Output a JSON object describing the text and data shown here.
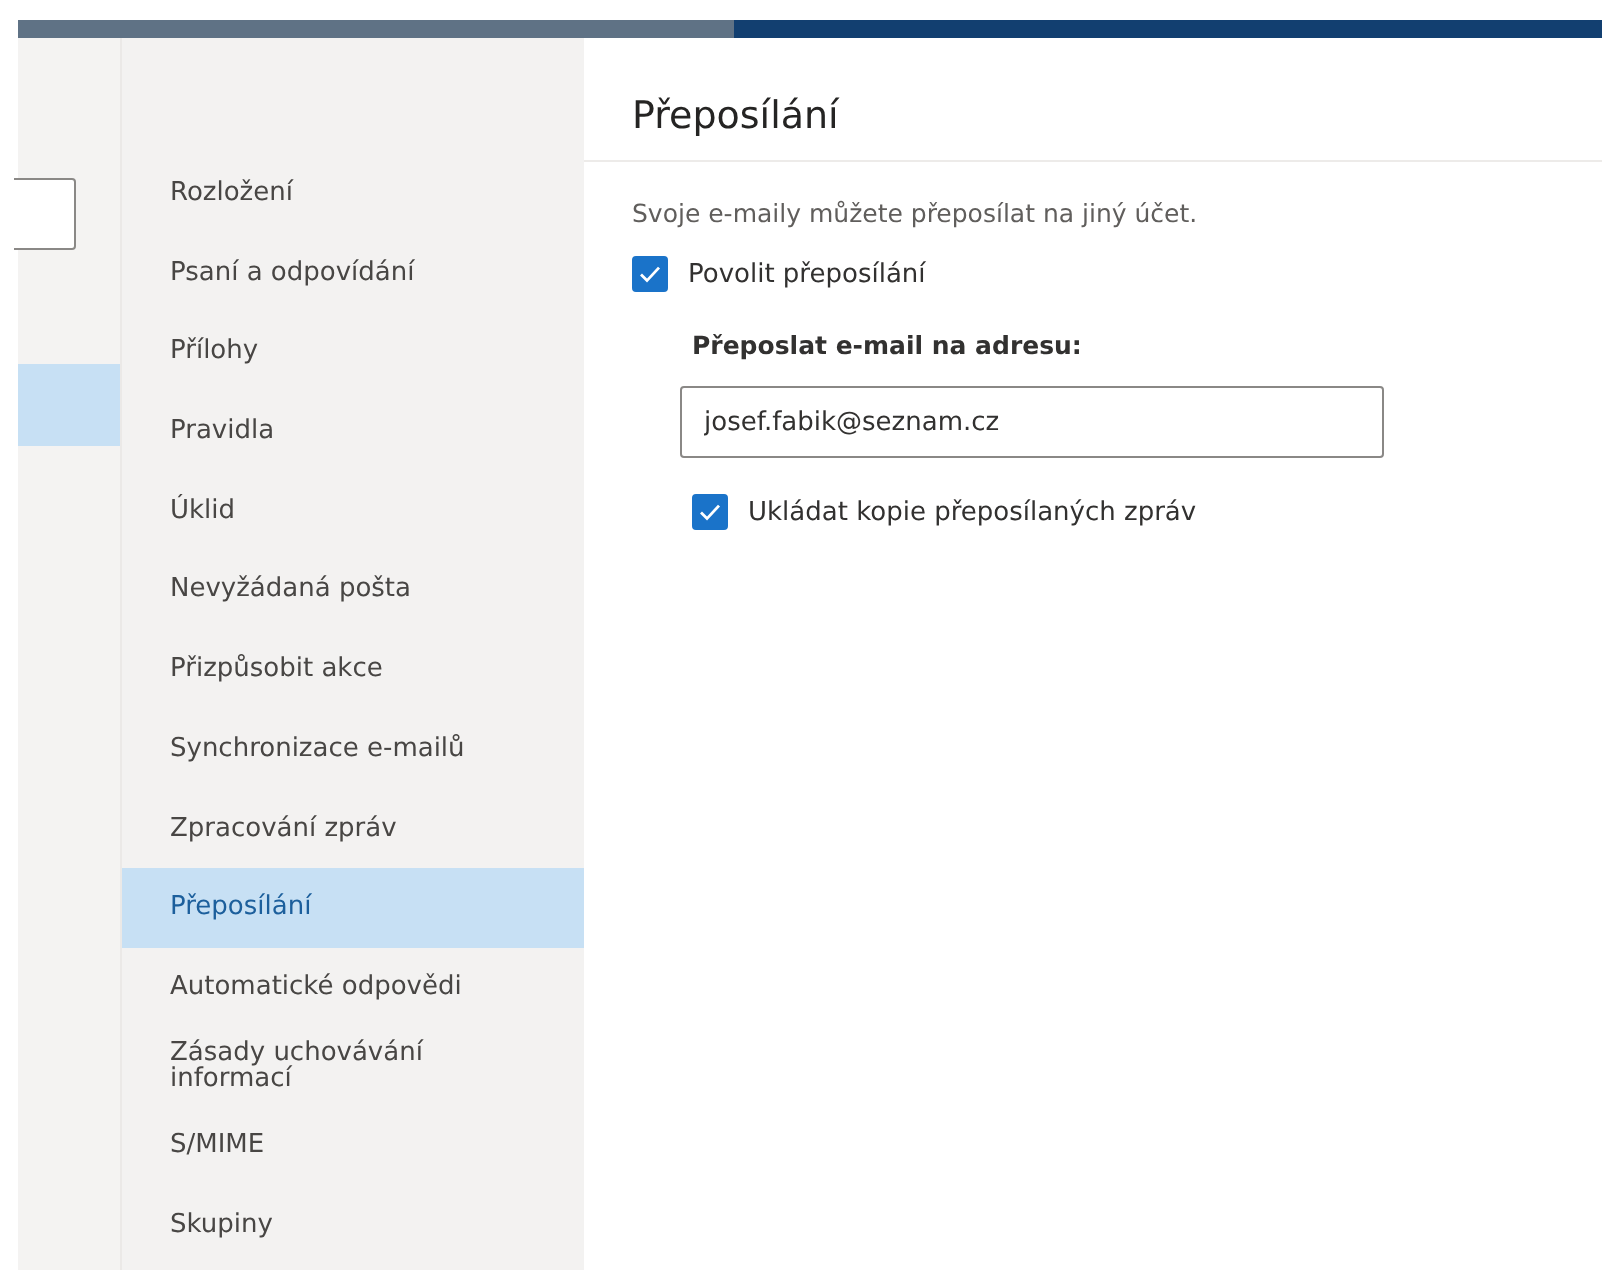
{
  "settings_menu": [
    {
      "label": "Rozložení",
      "selected": false
    },
    {
      "label": "Psaní a odpovídání",
      "selected": false
    },
    {
      "label": "Přílohy",
      "selected": false
    },
    {
      "label": "Pravidla",
      "selected": false
    },
    {
      "label": "Úklid",
      "selected": false
    },
    {
      "label": "Nevyžádaná pošta",
      "selected": false
    },
    {
      "label": "Přizpůsobit akce",
      "selected": false
    },
    {
      "label": "Synchronizace e-mailů",
      "selected": false
    },
    {
      "label": "Zpracování zpráv",
      "selected": false
    },
    {
      "label": "Přeposílání",
      "selected": true
    },
    {
      "label": "Automatické odpovědi",
      "selected": false
    },
    {
      "label": "Zásady uchovávání informací",
      "selected": false
    },
    {
      "label": "S/MIME",
      "selected": false
    },
    {
      "label": "Skupiny",
      "selected": false
    }
  ],
  "panel": {
    "title": "Přeposílání",
    "description": "Svoje e-maily můžete přeposílat na jiný účet.",
    "enable_forwarding": {
      "label": "Povolit přeposílání",
      "checked": true
    },
    "address_label": "Přeposlat e-mail na adresu:",
    "address_value": "josef.fabik@seznam.cz",
    "keep_copy": {
      "label": "Ukládat kopie přeposílaných zpráv",
      "checked": true
    }
  }
}
